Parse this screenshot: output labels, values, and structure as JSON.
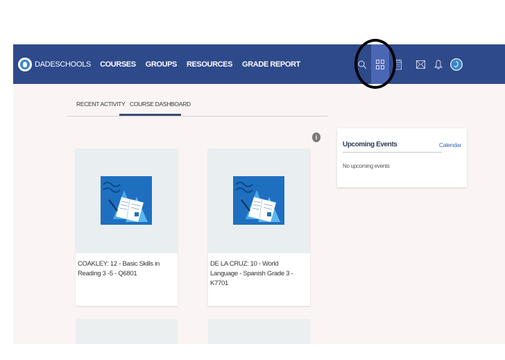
{
  "brand": {
    "name": "DADESCHOOLS"
  },
  "nav": {
    "links": [
      "COURSES",
      "GROUPS",
      "RESOURCES",
      "GRADE REPORT"
    ]
  },
  "icons": {
    "search": "search-icon",
    "dashboard": "grid-icon",
    "calendar": "calendar-icon",
    "inbox": "mail-icon",
    "notifications": "bell-icon",
    "profile": "avatar"
  },
  "tabs": [
    {
      "label": "RECENT ACTIVITY",
      "active": false
    },
    {
      "label": "COURSE DASHBOARD",
      "active": true
    }
  ],
  "info_badge": "i",
  "courses": [
    {
      "title": "COAKLEY: 12 - Basic Skills in Reading 3 -5 - Q6801"
    },
    {
      "title": "DE LA CRUZ: 10 - World Language - Spanish Grade 3 - K7701"
    }
  ],
  "events": {
    "title": "Upcoming Events",
    "link": "Calendar",
    "empty": "No upcoming events"
  },
  "colors": {
    "navbar": "#2e4a8b",
    "active_icon": "#4a67b4",
    "page_bg": "#faf5f4",
    "card_art": "#1f6fc0"
  }
}
